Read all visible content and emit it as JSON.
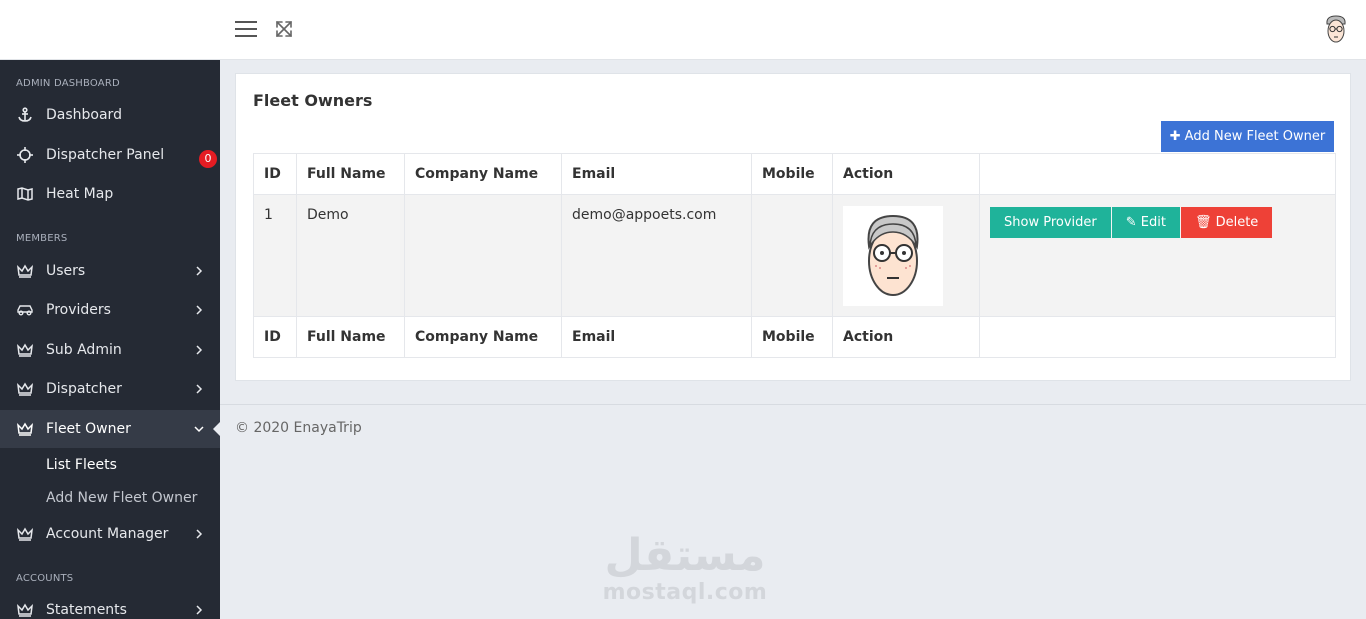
{
  "sidebar": {
    "sections": [
      "ADMIN DASHBOARD",
      "MEMBERS",
      "ACCOUNTS"
    ],
    "items": [
      {
        "label": "Dashboard",
        "icon": "anchor-icon"
      },
      {
        "label": "Dispatcher Panel",
        "icon": "crosshair-icon",
        "badge": "0"
      },
      {
        "label": "Heat Map",
        "icon": "map-icon"
      },
      {
        "label": "Users",
        "icon": "crown-icon"
      },
      {
        "label": "Providers",
        "icon": "car-icon"
      },
      {
        "label": "Sub Admin",
        "icon": "crown-icon"
      },
      {
        "label": "Dispatcher",
        "icon": "crown-icon"
      },
      {
        "label": "Fleet Owner",
        "icon": "crown-icon"
      },
      {
        "label": "Account Manager",
        "icon": "crown-icon"
      },
      {
        "label": "Statements",
        "icon": "crown-icon"
      }
    ],
    "sub_items": [
      "List Fleets",
      "Add New Fleet Owner"
    ]
  },
  "card": {
    "title": "Fleet Owners",
    "add_button": "Add New Fleet Owner"
  },
  "table": {
    "columns": [
      "ID",
      "Full Name",
      "Company Name",
      "Email",
      "Mobile",
      "Action"
    ],
    "rows": [
      {
        "id": "1",
        "full_name": "Demo",
        "company": "",
        "email": "demo@appoets.com",
        "mobile": ""
      }
    ],
    "actions": {
      "show": "Show Provider",
      "edit": "Edit",
      "delete": "Delete"
    }
  },
  "footer": {
    "text": "© 2020 EnayaTrip"
  },
  "watermark": {
    "arabic": "مستقل",
    "latin": "mostaql.com"
  },
  "colors": {
    "sidebar_bg": "#252a34",
    "primary": "#3c73d6",
    "success": "#1fb39a",
    "danger": "#ee4137",
    "badge": "#e51c23"
  }
}
